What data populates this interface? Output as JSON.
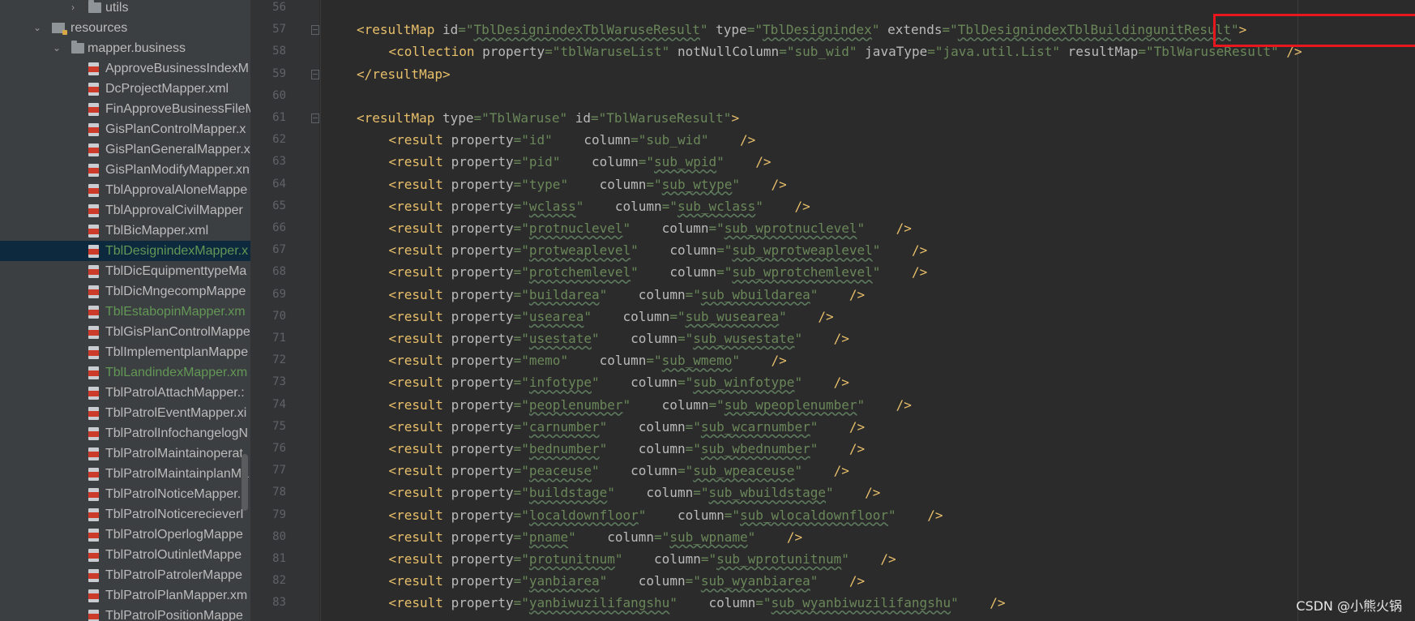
{
  "tree": {
    "rows": [
      {
        "label": "utils",
        "kind": "folder",
        "indent": 1,
        "arrow": "›"
      },
      {
        "label": "resources",
        "kind": "res",
        "indent": 0,
        "arrow": "⌄"
      },
      {
        "label": "mapper.business",
        "kind": "folder",
        "indent": 1,
        "arrow": "⌄"
      },
      {
        "label": "ApproveBusinessIndexM",
        "kind": "xml"
      },
      {
        "label": "DcProjectMapper.xml",
        "kind": "xml"
      },
      {
        "label": "FinApproveBusinessFileM",
        "kind": "xml"
      },
      {
        "label": "GisPlanControlMapper.x",
        "kind": "xml"
      },
      {
        "label": "GisPlanGeneralMapper.x",
        "kind": "xml"
      },
      {
        "label": "GisPlanModifyMapper.xn",
        "kind": "xml"
      },
      {
        "label": "TblApprovalAloneMappe",
        "kind": "xml"
      },
      {
        "label": "TblApprovalCivilMapper",
        "kind": "xml"
      },
      {
        "label": "TblBicMapper.xml",
        "kind": "xml"
      },
      {
        "label": "TblDesignindexMapper.x",
        "kind": "xml",
        "selected": true,
        "color": "green"
      },
      {
        "label": "TblDicEquipmenttypeMa",
        "kind": "xml"
      },
      {
        "label": "TblDicMngecompMappe",
        "kind": "xml"
      },
      {
        "label": "TblEstabopinMapper.xm",
        "kind": "xml",
        "color": "green"
      },
      {
        "label": "TblGisPlanControlMappe",
        "kind": "xml"
      },
      {
        "label": "TblImplementplanMappe",
        "kind": "xml"
      },
      {
        "label": "TblLandindexMapper.xm",
        "kind": "xml",
        "color": "green"
      },
      {
        "label": "TblPatrolAttachMapper.:",
        "kind": "xml"
      },
      {
        "label": "TblPatrolEventMapper.xi",
        "kind": "xml"
      },
      {
        "label": "TblPatrolInfochangelogN",
        "kind": "xml"
      },
      {
        "label": "TblPatrolMaintainoperat",
        "kind": "xml"
      },
      {
        "label": "TblPatrolMaintainplanMa",
        "kind": "xml"
      },
      {
        "label": "TblPatrolNoticeMapper.",
        "kind": "xml"
      },
      {
        "label": "TblPatrolNoticerecieverI",
        "kind": "xml"
      },
      {
        "label": "TblPatrolOperlogMappe",
        "kind": "xml"
      },
      {
        "label": "TblPatrolOutinletMappe",
        "kind": "xml"
      },
      {
        "label": "TblPatrolPatrolerMappe",
        "kind": "xml"
      },
      {
        "label": "TblPatrolPlanMapper.xm",
        "kind": "xml"
      },
      {
        "label": "TblPatrolPositionMappe",
        "kind": "xml"
      }
    ]
  },
  "editor": {
    "line_numbers": [
      "56",
      "57",
      "58",
      "59",
      "60",
      "61",
      "62",
      "63",
      "64",
      "65",
      "66",
      "67",
      "68",
      "69",
      "70",
      "71",
      "72",
      "73",
      "74",
      "75",
      "76",
      "77",
      "78",
      "79",
      "80",
      "81",
      "82",
      "83"
    ],
    "resultmap_open": {
      "tag": "resultMap",
      "attrs": [
        {
          "name": "id",
          "value": "TblDesignindexTblWaruseResult",
          "wavy": true
        },
        {
          "name": "type",
          "value": "TblDesignindex",
          "wavy": true
        },
        {
          "name": "extends",
          "value": "TblDesignindexTblBuildingunitResult",
          "wavy": true
        }
      ]
    },
    "collection": {
      "tag": "collection",
      "attrs": [
        {
          "name": "property",
          "value": "tblWaruseList"
        },
        {
          "name": "notNullColumn",
          "value": "sub_wid"
        },
        {
          "name": "javaType",
          "value": "java.util.List"
        },
        {
          "name": "resultMap",
          "value": "TblWaruseResult"
        }
      ],
      "close": "/>"
    },
    "resultmap_close": "</resultMap>",
    "resultmap2_open": {
      "tag": "resultMap",
      "attrs": [
        {
          "name": "type",
          "value": "TblWaruse"
        },
        {
          "name": "id",
          "value": "TblWaruseResult"
        }
      ]
    },
    "result_tag": "result",
    "result_rows": [
      {
        "property": "id",
        "column": "sub_wid",
        "pwavy": false,
        "cwavy": false
      },
      {
        "property": "pid",
        "column": "sub_wpid",
        "pwavy": false,
        "cwavy": true
      },
      {
        "property": "type",
        "column": "sub_wtype",
        "pwavy": false,
        "cwavy": true
      },
      {
        "property": "wclass",
        "column": "sub_wclass",
        "pwavy": true,
        "cwavy": true
      },
      {
        "property": "protnuclevel",
        "column": "sub_wprotnuclevel",
        "pwavy": true,
        "cwavy": true
      },
      {
        "property": "protweaplevel",
        "column": "sub_wprotweaplevel",
        "pwavy": true,
        "cwavy": true
      },
      {
        "property": "protchemlevel",
        "column": "sub_wprotchemlevel",
        "pwavy": true,
        "cwavy": true
      },
      {
        "property": "buildarea",
        "column": "sub_wbuildarea",
        "pwavy": true,
        "cwavy": true
      },
      {
        "property": "usearea",
        "column": "sub_wusearea",
        "pwavy": true,
        "cwavy": true
      },
      {
        "property": "usestate",
        "column": "sub_wusestate",
        "pwavy": true,
        "cwavy": true
      },
      {
        "property": "memo",
        "column": "sub_wmemo",
        "pwavy": false,
        "cwavy": true
      },
      {
        "property": "infotype",
        "column": "sub_winfotype",
        "pwavy": true,
        "cwavy": true
      },
      {
        "property": "peoplenumber",
        "column": "sub_wpeoplenumber",
        "pwavy": true,
        "cwavy": true
      },
      {
        "property": "carnumber",
        "column": "sub_wcarnumber",
        "pwavy": true,
        "cwavy": true
      },
      {
        "property": "bednumber",
        "column": "sub_wbednumber",
        "pwavy": true,
        "cwavy": true
      },
      {
        "property": "peaceuse",
        "column": "sub_wpeaceuse",
        "pwavy": true,
        "cwavy": true
      },
      {
        "property": "buildstage",
        "column": "sub_wbuildstage",
        "pwavy": true,
        "cwavy": true
      },
      {
        "property": "localdownfloor",
        "column": "sub_wlocaldownfloor",
        "pwavy": true,
        "cwavy": true
      },
      {
        "property": "pname",
        "column": "sub_wpname",
        "pwavy": true,
        "cwavy": true
      },
      {
        "property": "protunitnum",
        "column": "sub_wprotunitnum",
        "pwavy": true,
        "cwavy": true
      },
      {
        "property": "yanbiarea",
        "column": "sub_wyanbiarea",
        "pwavy": true,
        "cwavy": true
      },
      {
        "property": "yanbiwuzilifangshu",
        "column": "sub_wyanbiwuzilifangshu",
        "pwavy": true,
        "cwavy": true
      }
    ],
    "result_close": "/>"
  },
  "watermark": "CSDN @小熊火锅",
  "colors": {
    "highlight_border": "#e8171d",
    "tag": "#e8bf6a",
    "attr_value": "#6a8759"
  }
}
